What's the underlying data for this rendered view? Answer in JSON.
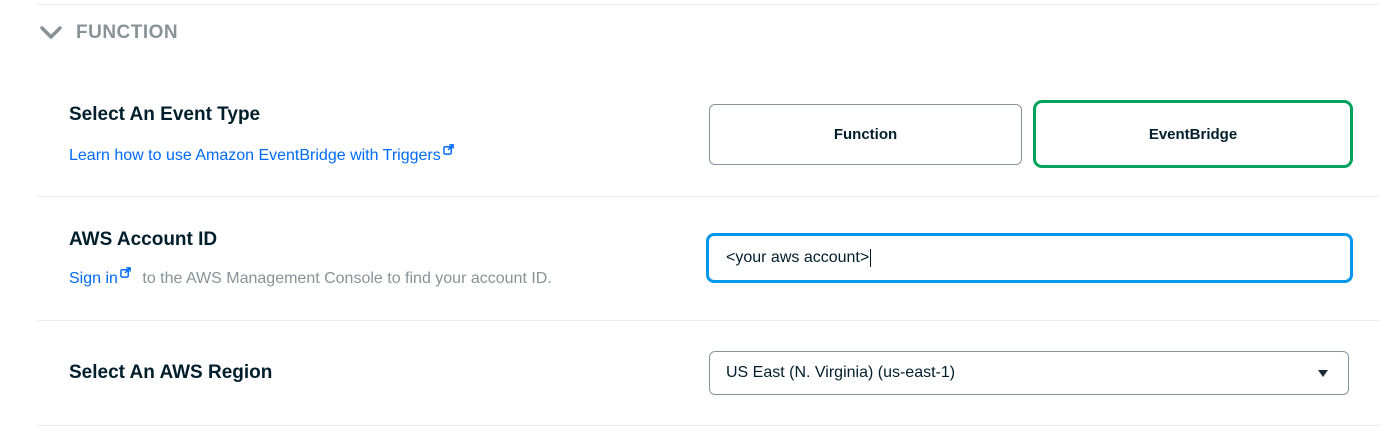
{
  "section": {
    "title": "FUNCTION"
  },
  "event_type": {
    "label": "Select An Event Type",
    "help_link": "Learn how to use Amazon EventBridge with Triggers",
    "options": [
      {
        "label": "Function",
        "selected": false
      },
      {
        "label": "EventBridge",
        "selected": true
      }
    ]
  },
  "account": {
    "label": "AWS Account ID",
    "help_link": "Sign in",
    "help_text": "to the AWS Management Console to find your account ID.",
    "value": "<your aws account>"
  },
  "region": {
    "label": "Select An AWS Region",
    "selected": "US East (N. Virginia) (us-east-1)"
  },
  "colors": {
    "selected_border": "#00a35c",
    "focus_border": "#0498ec",
    "link": "#016bf8"
  }
}
